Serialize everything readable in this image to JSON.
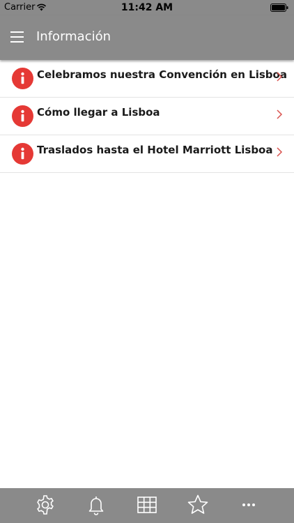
{
  "status_bar": {
    "carrier": "Carrier",
    "time": "11:42 AM",
    "icons": [
      "wifi-icon",
      "battery-icon"
    ]
  },
  "nav": {
    "title": "Información",
    "menu_icon": "hamburger-menu-icon"
  },
  "list": {
    "items": [
      {
        "label": "Celebramos nuestra Convención en Lisboa",
        "icon": "info-icon"
      },
      {
        "label": "Cómo llegar a Lisboa",
        "icon": "info-icon"
      },
      {
        "label": "Traslados hasta el Hotel Marriott Lisboa",
        "icon": "info-icon"
      }
    ]
  },
  "tab_bar": {
    "tabs": [
      {
        "icon": "gear-icon"
      },
      {
        "icon": "bell-icon"
      },
      {
        "icon": "grid-icon"
      },
      {
        "icon": "star-icon"
      },
      {
        "icon": "more-icon"
      }
    ]
  },
  "colors": {
    "bar_background": "#8a8a8a",
    "info_icon_red": "#e53935",
    "chevron_red": "#d9534f",
    "separator": "#e3e3e3"
  }
}
